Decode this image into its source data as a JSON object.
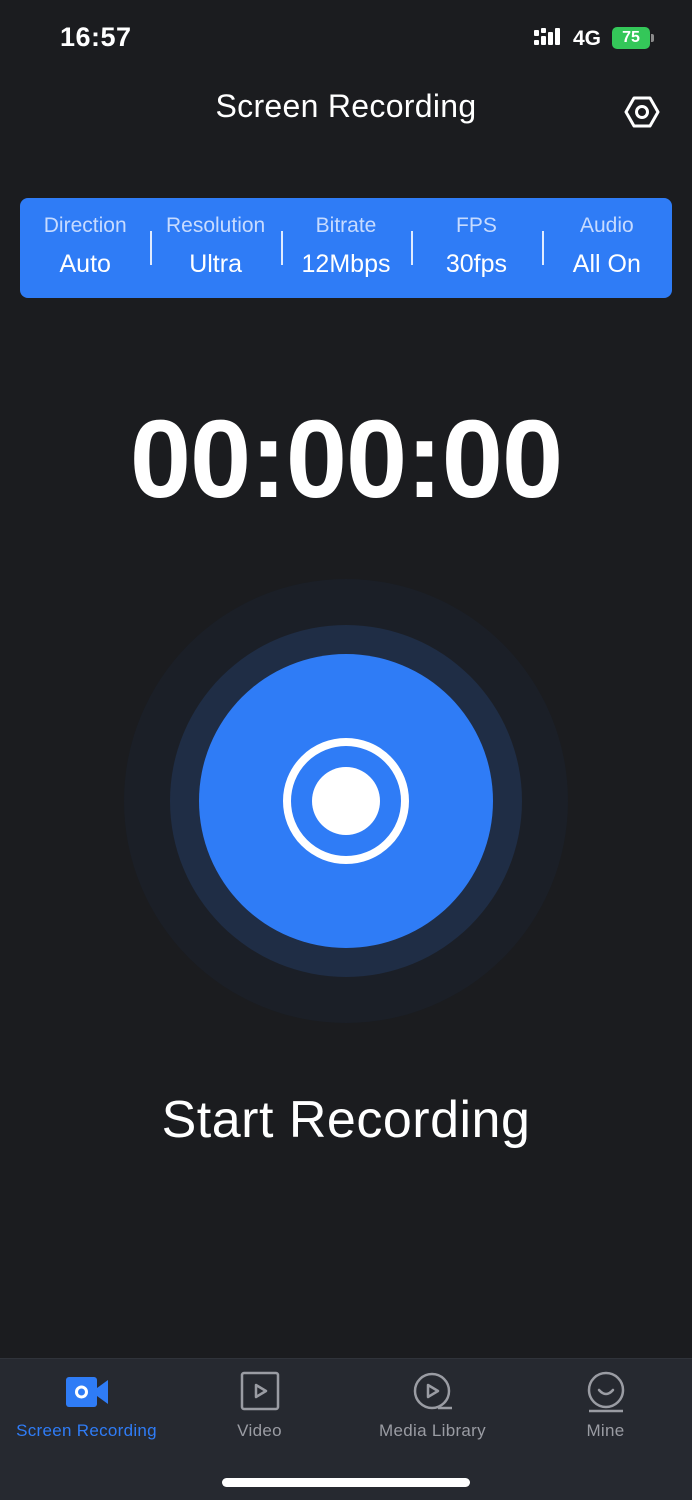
{
  "status_bar": {
    "time": "16:57",
    "network": "4G",
    "battery": "75",
    "battery_color": "#34c759"
  },
  "header": {
    "title": "Screen Recording",
    "settings_icon": "gear-icon"
  },
  "settings": [
    {
      "label": "Direction",
      "value": "Auto"
    },
    {
      "label": "Resolution",
      "value": "Ultra"
    },
    {
      "label": "Bitrate",
      "value": "12Mbps"
    },
    {
      "label": "FPS",
      "value": "30fps"
    },
    {
      "label": "Audio",
      "value": "All On"
    }
  ],
  "timer": "00:00:00",
  "record": {
    "label": "Start Recording",
    "accent": "#2f7cf6",
    "icon": "record-icon"
  },
  "tabs": [
    {
      "label": "Screen Recording",
      "icon": "video-camera-icon",
      "active": true
    },
    {
      "label": "Video",
      "icon": "play-square-icon",
      "active": false
    },
    {
      "label": "Media Library",
      "icon": "play-circle-icon",
      "active": false
    },
    {
      "label": "Mine",
      "icon": "smile-icon",
      "active": false
    }
  ]
}
